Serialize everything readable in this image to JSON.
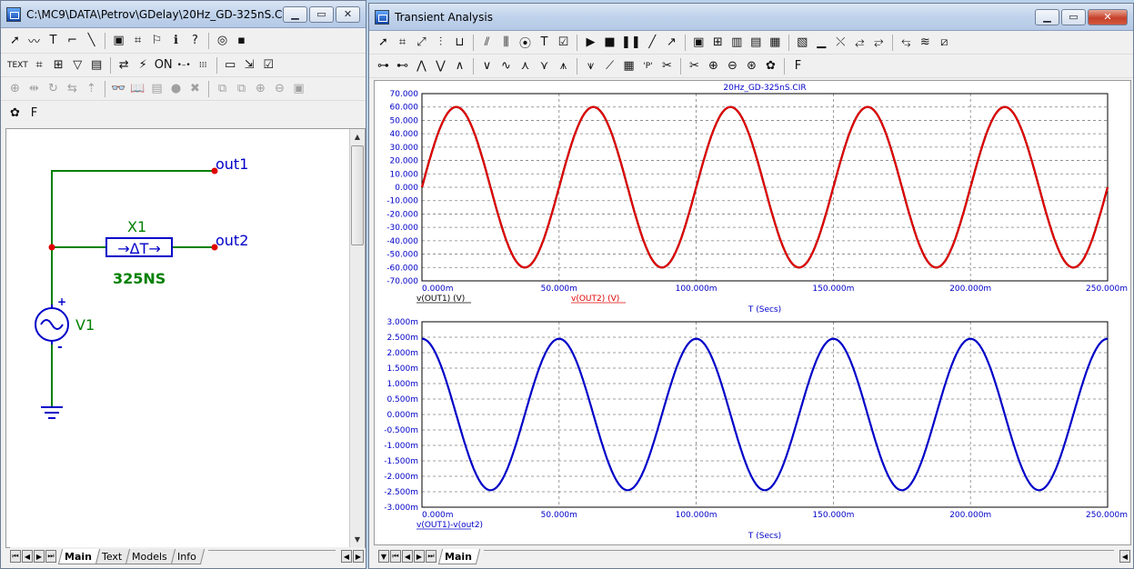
{
  "schematic": {
    "title": "C:\\MC9\\DATA\\Petrov\\GDelay\\20Hz_GD-325nS.CIR",
    "toolbar1": [
      {
        "icon": "select-arrow-icon",
        "glyph": "➚"
      },
      {
        "icon": "wire-icon",
        "glyph": "〰"
      },
      {
        "icon": "text-tool-icon",
        "glyph": "T"
      },
      {
        "icon": "orthogonal-wire-icon",
        "glyph": "⌐"
      },
      {
        "icon": "diagonal-wire-icon",
        "glyph": "╲"
      },
      {
        "icon": "bus-icon",
        "glyph": "▣"
      },
      {
        "icon": "shapes-icon",
        "glyph": "⌗"
      },
      {
        "icon": "flag-icon",
        "glyph": "⚐"
      },
      {
        "icon": "info-icon",
        "glyph": "ℹ"
      },
      {
        "icon": "help-icon",
        "glyph": "?"
      },
      {
        "icon": "point-icon",
        "glyph": "◎"
      },
      {
        "icon": "probe-icon",
        "glyph": "▪"
      }
    ],
    "toolbar2": [
      {
        "icon": "text-mode-icon",
        "glyph": "TEXT"
      },
      {
        "icon": "node-numbers-icon",
        "glyph": "⌗"
      },
      {
        "icon": "pin-connections-icon",
        "glyph": "⊞"
      },
      {
        "icon": "attribute-text-icon",
        "glyph": "▽"
      },
      {
        "icon": "node-voltage-icon",
        "glyph": "▤"
      },
      {
        "icon": "current-icon",
        "glyph": "⇄"
      },
      {
        "icon": "power-icon",
        "glyph": "⚡"
      },
      {
        "icon": "on-state-icon",
        "glyph": "ON"
      },
      {
        "icon": "pin-markers-icon",
        "glyph": "•–•"
      },
      {
        "icon": "grid-icon",
        "glyph": "⁞⁞⁞"
      },
      {
        "icon": "border-icon",
        "glyph": "▭"
      },
      {
        "icon": "title-icon",
        "glyph": "⇲"
      },
      {
        "icon": "properties-icon",
        "glyph": "☑"
      }
    ],
    "toolbar3": [
      {
        "icon": "mirror-icon",
        "glyph": "⊕"
      },
      {
        "icon": "flip-icon",
        "glyph": "⇹"
      },
      {
        "icon": "rotate-icon",
        "glyph": "↻"
      },
      {
        "icon": "flip-y-icon",
        "glyph": "⇆"
      },
      {
        "icon": "step-icon",
        "glyph": "⇡"
      },
      {
        "icon": "find-icon",
        "glyph": "👓"
      },
      {
        "icon": "book-icon",
        "glyph": "📖"
      },
      {
        "icon": "display-icon",
        "glyph": "▤"
      },
      {
        "icon": "warning-icon",
        "glyph": "●"
      },
      {
        "icon": "stop-icon",
        "glyph": "✖"
      },
      {
        "icon": "copy-icon",
        "glyph": "⧉"
      },
      {
        "icon": "paste-icon",
        "glyph": "⧉"
      },
      {
        "icon": "zoom-in-icon",
        "glyph": "⊕"
      },
      {
        "icon": "zoom-out-icon",
        "glyph": "⊖"
      },
      {
        "icon": "camera-icon",
        "glyph": "▣"
      }
    ],
    "toolbar4": [
      {
        "icon": "palette-icon",
        "glyph": "✿"
      },
      {
        "icon": "font-icon",
        "glyph": "F"
      }
    ],
    "labels": {
      "out1": "out1",
      "out2": "out2",
      "x1": "X1",
      "delay_symbol": "→ΔT→",
      "delay_value": "325NS",
      "v1": "V1",
      "plus": "+",
      "minus": "-"
    },
    "tabs": [
      "Main",
      "Text",
      "Models",
      "Info"
    ],
    "active_tab": "Main"
  },
  "analysis": {
    "title": "Transient Analysis",
    "toolbar1": [
      {
        "icon": "select-arrow-icon",
        "glyph": "➚"
      },
      {
        "icon": "shapes-icon",
        "glyph": "⌗"
      },
      {
        "icon": "scale-icon",
        "glyph": "⤢"
      },
      {
        "icon": "data-points-icon",
        "glyph": "⫶"
      },
      {
        "icon": "tokens-icon",
        "glyph": "⊔"
      },
      {
        "icon": "horizontal-tag-icon",
        "glyph": "⫽"
      },
      {
        "icon": "vertical-tag-icon",
        "glyph": "⫼"
      },
      {
        "icon": "point-tag-icon",
        "glyph": "⦿"
      },
      {
        "icon": "text-tool-icon",
        "glyph": "T"
      },
      {
        "icon": "properties-icon",
        "glyph": "☑"
      },
      {
        "icon": "run-icon",
        "glyph": "▶"
      },
      {
        "icon": "stop-icon",
        "glyph": "■"
      },
      {
        "icon": "pause-icon",
        "glyph": "❚❚"
      },
      {
        "icon": "line-icon",
        "glyph": "╱"
      },
      {
        "icon": "arrow-line-icon",
        "glyph": "↗"
      },
      {
        "icon": "frame-icon",
        "glyph": "▣"
      },
      {
        "icon": "grid-icon",
        "glyph": "⊞"
      },
      {
        "icon": "minor-grid-icon",
        "glyph": "▥"
      },
      {
        "icon": "major-grid-icon",
        "glyph": "▤"
      },
      {
        "icon": "y-grid-icon",
        "glyph": "▦"
      },
      {
        "icon": "x-grid-icon",
        "glyph": "▧"
      },
      {
        "icon": "baseline-icon",
        "glyph": "▁"
      },
      {
        "icon": "horizontal-axis-icon",
        "glyph": "⤬"
      },
      {
        "icon": "cursor-left-icon",
        "glyph": "⥄"
      },
      {
        "icon": "cursor-right-icon",
        "glyph": "⥂"
      },
      {
        "icon": "cursor-both-icon",
        "glyph": "⥃"
      },
      {
        "icon": "cursor-mode-icon",
        "glyph": "≋"
      },
      {
        "icon": "animate-icon",
        "glyph": "⧄"
      }
    ],
    "toolbar2": [
      {
        "icon": "next-data-point-icon",
        "glyph": "⊶"
      },
      {
        "icon": "next-interpolated-icon",
        "glyph": "⊷"
      },
      {
        "icon": "peak-icon",
        "glyph": "⋀"
      },
      {
        "icon": "valley-icon",
        "glyph": "⋁"
      },
      {
        "icon": "high-icon",
        "glyph": "∧"
      },
      {
        "icon": "low-icon",
        "glyph": "∨"
      },
      {
        "icon": "inflection-icon",
        "glyph": "∿"
      },
      {
        "icon": "global-high-icon",
        "glyph": "⋏"
      },
      {
        "icon": "global-low-icon",
        "glyph": "⋎"
      },
      {
        "icon": "top-icon",
        "glyph": "⩚"
      },
      {
        "icon": "bottom-icon",
        "glyph": "⩛"
      },
      {
        "icon": "slope-icon",
        "glyph": "⟋"
      },
      {
        "icon": "table-icon",
        "glyph": "▦"
      },
      {
        "icon": "performance-icon",
        "glyph": "'P'"
      },
      {
        "icon": "cursor-tag-left-icon",
        "glyph": "✂"
      },
      {
        "icon": "cursor-tag-right-icon",
        "glyph": "✂"
      },
      {
        "icon": "zoom-in-icon",
        "glyph": "⊕"
      },
      {
        "icon": "zoom-out-icon",
        "glyph": "⊖"
      },
      {
        "icon": "zoom-fit-icon",
        "glyph": "⊛"
      },
      {
        "icon": "palette-icon",
        "glyph": "✿"
      },
      {
        "icon": "font-icon",
        "glyph": "F"
      }
    ],
    "tabs": [
      "Main"
    ],
    "active_tab": "Main"
  },
  "chart_data": [
    {
      "type": "line",
      "title": "20Hz_GD-325nS.CIR",
      "xlabel": "T (Secs)",
      "x_ticks": [
        "0.000m",
        "50.000m",
        "100.000m",
        "150.000m",
        "200.000m",
        "250.000m"
      ],
      "y_ticks": [
        "70.000",
        "60.000",
        "50.000",
        "40.000",
        "30.000",
        "20.000",
        "10.000",
        "0.000",
        "-10.000",
        "-20.000",
        "-30.000",
        "-40.000",
        "-50.000",
        "-60.000",
        "-70.000"
      ],
      "xlim": [
        0,
        250
      ],
      "ylim": [
        -70,
        70
      ],
      "grid": true,
      "series": [
        {
          "name": "v(OUT1) (V)",
          "color": "#000000",
          "amplitude": 60,
          "frequency_hz": 20,
          "phase_deg": 0,
          "offset": 0
        },
        {
          "name": "v(OUT2) (V)",
          "color": "#e00000",
          "amplitude": 60,
          "frequency_hz": 20,
          "phase_deg": 0,
          "offset": 0
        }
      ]
    },
    {
      "type": "line",
      "title": "",
      "xlabel": "T (Secs)",
      "x_ticks": [
        "0.000m",
        "50.000m",
        "100.000m",
        "150.000m",
        "200.000m",
        "250.000m"
      ],
      "y_ticks": [
        "3.000m",
        "2.500m",
        "2.000m",
        "1.500m",
        "1.000m",
        "0.500m",
        "0.000m",
        "-0.500m",
        "-1.000m",
        "-1.500m",
        "-2.000m",
        "-2.500m",
        "-3.000m"
      ],
      "xlim": [
        0,
        250
      ],
      "ylim": [
        -3.0,
        3.0
      ],
      "grid": true,
      "series": [
        {
          "name": "v(OUT1)-v(out2)",
          "color": "#0000c8",
          "amplitude": 2.45,
          "frequency_hz": 20,
          "phase_deg": 90,
          "offset": 0
        }
      ]
    }
  ]
}
